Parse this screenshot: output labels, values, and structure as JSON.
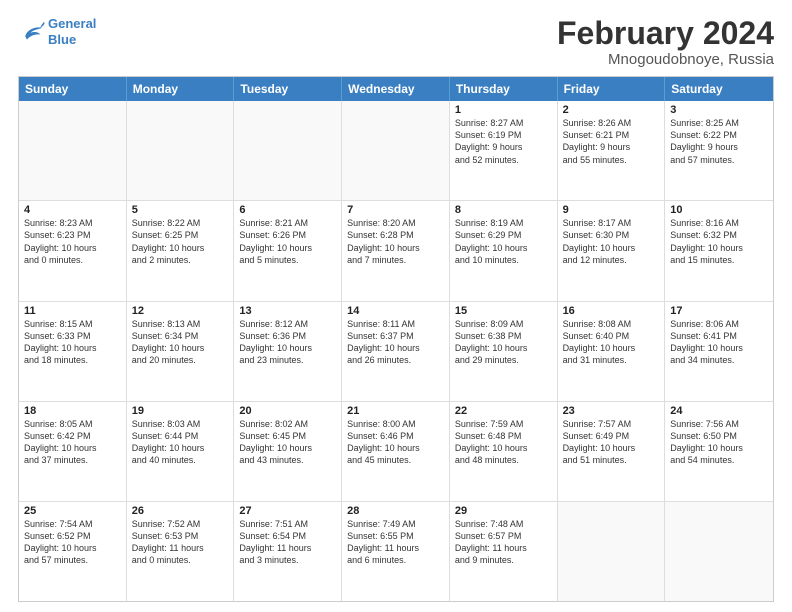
{
  "logo": {
    "line1": "General",
    "line2": "Blue"
  },
  "title": "February 2024",
  "location": "Mnogoudobnoye, Russia",
  "days_of_week": [
    "Sunday",
    "Monday",
    "Tuesday",
    "Wednesday",
    "Thursday",
    "Friday",
    "Saturday"
  ],
  "weeks": [
    [
      {
        "day": "",
        "text": "",
        "empty": true
      },
      {
        "day": "",
        "text": "",
        "empty": true
      },
      {
        "day": "",
        "text": "",
        "empty": true
      },
      {
        "day": "",
        "text": "",
        "empty": true
      },
      {
        "day": "1",
        "text": "Sunrise: 8:27 AM\nSunset: 6:19 PM\nDaylight: 9 hours\nand 52 minutes."
      },
      {
        "day": "2",
        "text": "Sunrise: 8:26 AM\nSunset: 6:21 PM\nDaylight: 9 hours\nand 55 minutes."
      },
      {
        "day": "3",
        "text": "Sunrise: 8:25 AM\nSunset: 6:22 PM\nDaylight: 9 hours\nand 57 minutes."
      }
    ],
    [
      {
        "day": "4",
        "text": "Sunrise: 8:23 AM\nSunset: 6:23 PM\nDaylight: 10 hours\nand 0 minutes."
      },
      {
        "day": "5",
        "text": "Sunrise: 8:22 AM\nSunset: 6:25 PM\nDaylight: 10 hours\nand 2 minutes."
      },
      {
        "day": "6",
        "text": "Sunrise: 8:21 AM\nSunset: 6:26 PM\nDaylight: 10 hours\nand 5 minutes."
      },
      {
        "day": "7",
        "text": "Sunrise: 8:20 AM\nSunset: 6:28 PM\nDaylight: 10 hours\nand 7 minutes."
      },
      {
        "day": "8",
        "text": "Sunrise: 8:19 AM\nSunset: 6:29 PM\nDaylight: 10 hours\nand 10 minutes."
      },
      {
        "day": "9",
        "text": "Sunrise: 8:17 AM\nSunset: 6:30 PM\nDaylight: 10 hours\nand 12 minutes."
      },
      {
        "day": "10",
        "text": "Sunrise: 8:16 AM\nSunset: 6:32 PM\nDaylight: 10 hours\nand 15 minutes."
      }
    ],
    [
      {
        "day": "11",
        "text": "Sunrise: 8:15 AM\nSunset: 6:33 PM\nDaylight: 10 hours\nand 18 minutes."
      },
      {
        "day": "12",
        "text": "Sunrise: 8:13 AM\nSunset: 6:34 PM\nDaylight: 10 hours\nand 20 minutes."
      },
      {
        "day": "13",
        "text": "Sunrise: 8:12 AM\nSunset: 6:36 PM\nDaylight: 10 hours\nand 23 minutes."
      },
      {
        "day": "14",
        "text": "Sunrise: 8:11 AM\nSunset: 6:37 PM\nDaylight: 10 hours\nand 26 minutes."
      },
      {
        "day": "15",
        "text": "Sunrise: 8:09 AM\nSunset: 6:38 PM\nDaylight: 10 hours\nand 29 minutes."
      },
      {
        "day": "16",
        "text": "Sunrise: 8:08 AM\nSunset: 6:40 PM\nDaylight: 10 hours\nand 31 minutes."
      },
      {
        "day": "17",
        "text": "Sunrise: 8:06 AM\nSunset: 6:41 PM\nDaylight: 10 hours\nand 34 minutes."
      }
    ],
    [
      {
        "day": "18",
        "text": "Sunrise: 8:05 AM\nSunset: 6:42 PM\nDaylight: 10 hours\nand 37 minutes."
      },
      {
        "day": "19",
        "text": "Sunrise: 8:03 AM\nSunset: 6:44 PM\nDaylight: 10 hours\nand 40 minutes."
      },
      {
        "day": "20",
        "text": "Sunrise: 8:02 AM\nSunset: 6:45 PM\nDaylight: 10 hours\nand 43 minutes."
      },
      {
        "day": "21",
        "text": "Sunrise: 8:00 AM\nSunset: 6:46 PM\nDaylight: 10 hours\nand 45 minutes."
      },
      {
        "day": "22",
        "text": "Sunrise: 7:59 AM\nSunset: 6:48 PM\nDaylight: 10 hours\nand 48 minutes."
      },
      {
        "day": "23",
        "text": "Sunrise: 7:57 AM\nSunset: 6:49 PM\nDaylight: 10 hours\nand 51 minutes."
      },
      {
        "day": "24",
        "text": "Sunrise: 7:56 AM\nSunset: 6:50 PM\nDaylight: 10 hours\nand 54 minutes."
      }
    ],
    [
      {
        "day": "25",
        "text": "Sunrise: 7:54 AM\nSunset: 6:52 PM\nDaylight: 10 hours\nand 57 minutes."
      },
      {
        "day": "26",
        "text": "Sunrise: 7:52 AM\nSunset: 6:53 PM\nDaylight: 11 hours\nand 0 minutes."
      },
      {
        "day": "27",
        "text": "Sunrise: 7:51 AM\nSunset: 6:54 PM\nDaylight: 11 hours\nand 3 minutes."
      },
      {
        "day": "28",
        "text": "Sunrise: 7:49 AM\nSunset: 6:55 PM\nDaylight: 11 hours\nand 6 minutes."
      },
      {
        "day": "29",
        "text": "Sunrise: 7:48 AM\nSunset: 6:57 PM\nDaylight: 11 hours\nand 9 minutes."
      },
      {
        "day": "",
        "text": "",
        "empty": true
      },
      {
        "day": "",
        "text": "",
        "empty": true
      }
    ]
  ]
}
